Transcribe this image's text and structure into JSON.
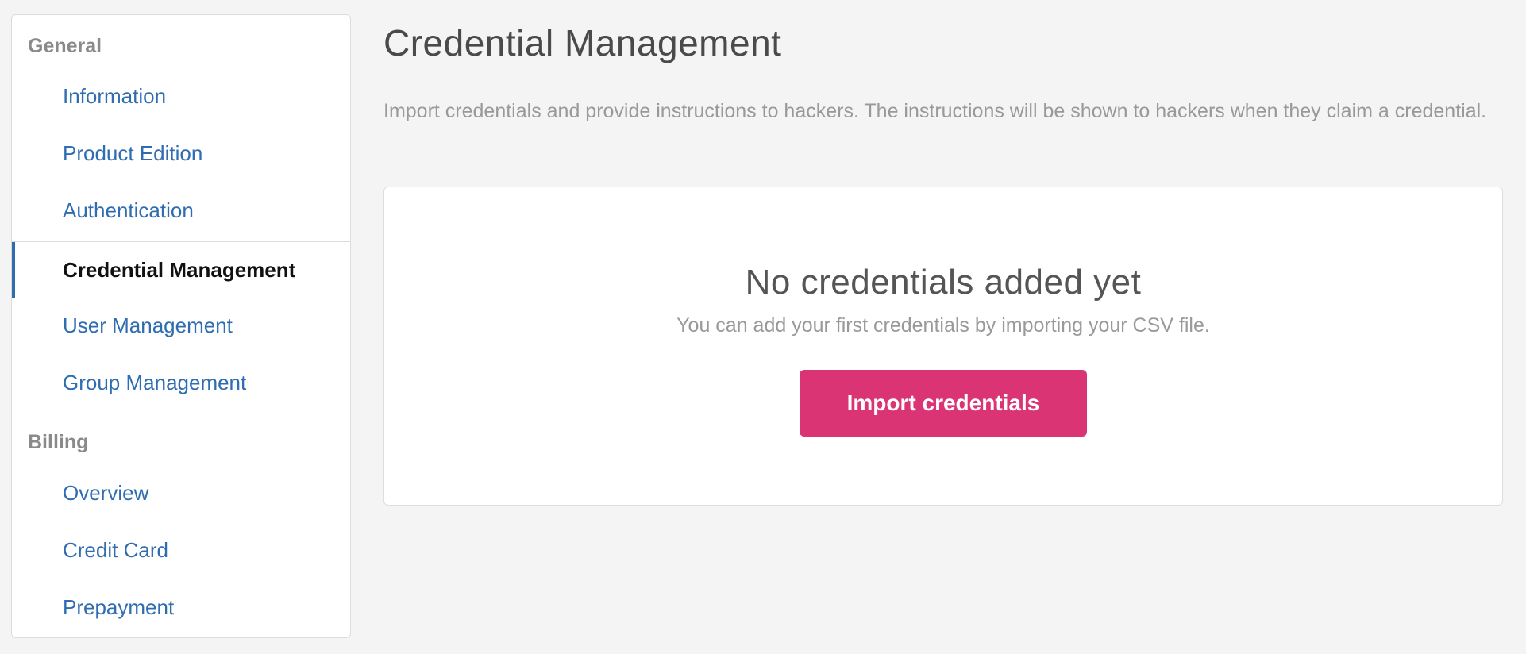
{
  "sidebar": {
    "sections": [
      {
        "heading": "General",
        "items": [
          {
            "label": "Information"
          },
          {
            "label": "Product Edition"
          },
          {
            "label": "Authentication"
          },
          {
            "label": "Credential Management",
            "active": true
          },
          {
            "label": "User Management"
          },
          {
            "label": "Group Management"
          }
        ]
      },
      {
        "heading": "Billing",
        "items": [
          {
            "label": "Overview"
          },
          {
            "label": "Credit Card"
          },
          {
            "label": "Prepayment"
          }
        ]
      }
    ]
  },
  "main": {
    "title": "Credential Management",
    "description": "Import credentials and provide instructions to hackers. The instructions will be shown to hackers when they claim a credential.",
    "empty_state": {
      "title": "No credentials added yet",
      "subtitle": "You can add your first credentials by importing your CSV file.",
      "button_label": "Import credentials"
    }
  },
  "colors": {
    "link": "#2f6db0",
    "accent_button": "#db3474",
    "background": "#f4f4f4"
  }
}
